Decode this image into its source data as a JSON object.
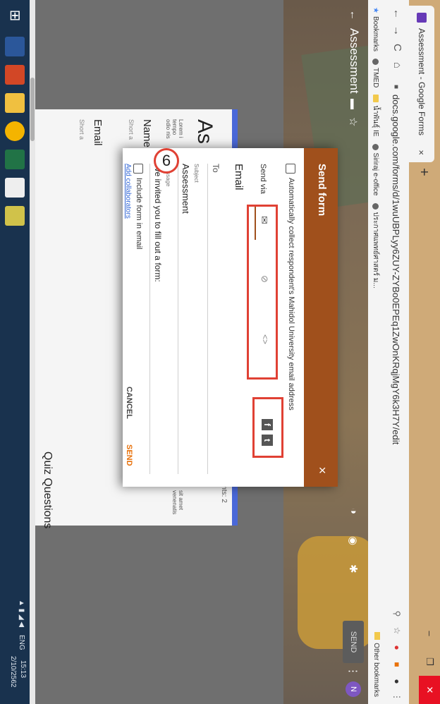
{
  "browser": {
    "tab_title": "Assessment - Google Forms",
    "tab_close": "×",
    "new_tab": "+",
    "window_min": "–",
    "window_restore": "❐",
    "window_close": "✕",
    "nav_back": "←",
    "nav_forward": "→",
    "nav_reload": "C",
    "nav_home": "⌂",
    "url": "docs.google.com/forms/d/1wuUBPLyy6ZUY-ZYBo0EPEq1ZwOnKRqjMgY6k3H7Y/edit",
    "bookmarks_label": "Bookmarks",
    "bookmarks": [
      "TMED",
      "น้ำพันธุ์ IE",
      "Siriraj e-office",
      "ประกาศแพทย์ศาสตร์ ม..."
    ],
    "other_bookmarks": "Other bookmarks"
  },
  "forms_header": {
    "back": "←",
    "title": "Assessment",
    "send_label": "SEND",
    "avatar": "N"
  },
  "form_behind": {
    "points": "points: 2",
    "title_partial": "As",
    "desc_left": "Lorem i\ntempo\nodio nis",
    "desc_right": "sit amet\nvenenatis",
    "name_label": "Name",
    "name_hint": "Short a",
    "email_label": "Email",
    "email_hint": "Short a",
    "quiz_questions": "Quiz Questions"
  },
  "send_form": {
    "title": "Send form",
    "close": "×",
    "collect_emails": "Automatically collect respondent's Mahidol University email address",
    "send_via": "Send via",
    "email_tab_title": "Email",
    "to_label": "To",
    "subject_label": "Subject",
    "subject_value": "Assessment",
    "message_label": "Message",
    "message_value": "I've invited you to fill out a form:",
    "include_form": "Include form in email",
    "add_collaborators": "Add collaborators",
    "cancel": "CANCEL",
    "send": "SEND",
    "facebook": "f",
    "twitter": "t"
  },
  "annotation": {
    "step_number": "6"
  },
  "taskbar": {
    "lang": "ENG",
    "time": "15:13",
    "date": "2/10/2562"
  },
  "colors": {
    "modal_header": "#a0501c",
    "annotation_red": "#e04134",
    "form_accent": "#4a68d8",
    "send_orange": "#e8710a"
  }
}
